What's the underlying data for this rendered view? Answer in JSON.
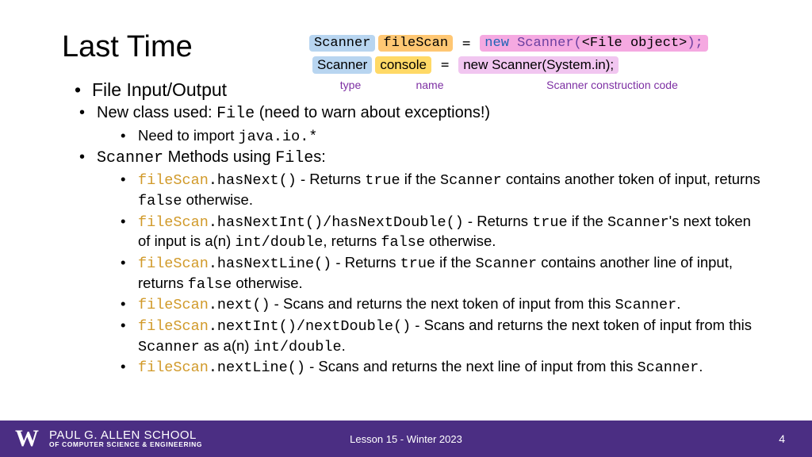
{
  "title": "Last Time",
  "diagram": {
    "row1": {
      "type": "Scanner",
      "name": "fileScan",
      "equals": "=",
      "new": "new",
      "ctor": "Scanner(",
      "arg": "<File object>",
      "close": ");"
    },
    "row2": {
      "type": "Scanner",
      "name": "console",
      "equals": "=",
      "rhs": "new Scanner(System.in);"
    },
    "labels": {
      "type": "type",
      "name": "name",
      "constr": "Scanner construction code"
    }
  },
  "bullets": {
    "top": "File Input/Output",
    "b2a_prefix": "New class used: ",
    "b2a_code": "File",
    "b2a_suffix": " (need to warn about exceptions!)",
    "b3a_prefix": "Need to import ",
    "b3a_code": "java.io.*",
    "b2b_code": "Scanner",
    "b2b_mid": " Methods using ",
    "b2b_code2": "File",
    "b2b_suffix": "s:",
    "m1_obj": "fileScan",
    "m1_call": ".hasNext()",
    "m1_rest_a": " - Returns ",
    "m1_true": "true",
    "m1_rest_b": " if the ",
    "m1_scn": "Scanner",
    "m1_rest_c": " contains another token of input, returns ",
    "m1_false": "false",
    "m1_rest_d": " otherwise.",
    "m2_call": ".hasNextInt()/hasNextDouble()",
    "m2_rest_a": " - Returns ",
    "m2_rest_b": " if the ",
    "m2_rest_c": "'s next token of input is a(n) ",
    "m2_types": "int/double",
    "m2_rest_d": ", returns ",
    "m2_rest_e": " otherwise.",
    "m3_call": ".hasNextLine()",
    "m3_rest": " contains another line of input, returns ",
    "m4_call": ".next()",
    "m4_rest": " - Scans and returns the next token of input from this ",
    "m4_end": ".",
    "m5_call": ".nextInt()/nextDouble()",
    "m5_rest_a": " - Scans and returns the next token of input from this ",
    "m5_rest_b": " as a(n) ",
    "m5_rest_c": ".",
    "m6_call": ".nextLine()",
    "m6_rest": " - Scans and returns the next line of input from this "
  },
  "footer": {
    "w": "W",
    "school_top": "PAUL G. ALLEN SCHOOL",
    "school_bottom": "OF COMPUTER SCIENCE & ENGINEERING",
    "center": "Lesson 15 - Winter 2023",
    "page": "4"
  }
}
